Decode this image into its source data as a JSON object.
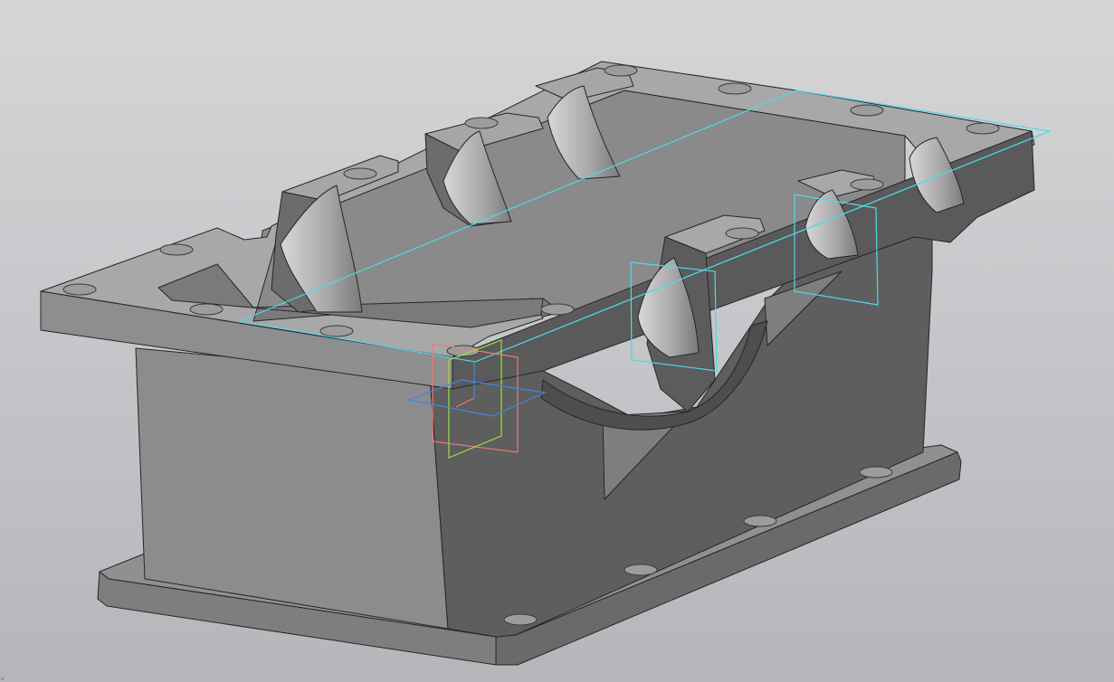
{
  "viewport": {
    "background_top": "#d6d6d8",
    "background_bottom": "#b4b6ba",
    "model_colors": {
      "light": "#b0b0b0",
      "mid": "#8e8e8e",
      "dark": "#5e5e5e",
      "darker": "#4e4e4e",
      "edge": "#262626",
      "hole": "#9c9c9c"
    },
    "sketch_color": "#4fd9e6",
    "axis_plane_colors": {
      "zy": "#ee7a7a",
      "zx": "#9be040",
      "xy": "#3f86e8"
    },
    "origin_glyph": "⌄"
  }
}
